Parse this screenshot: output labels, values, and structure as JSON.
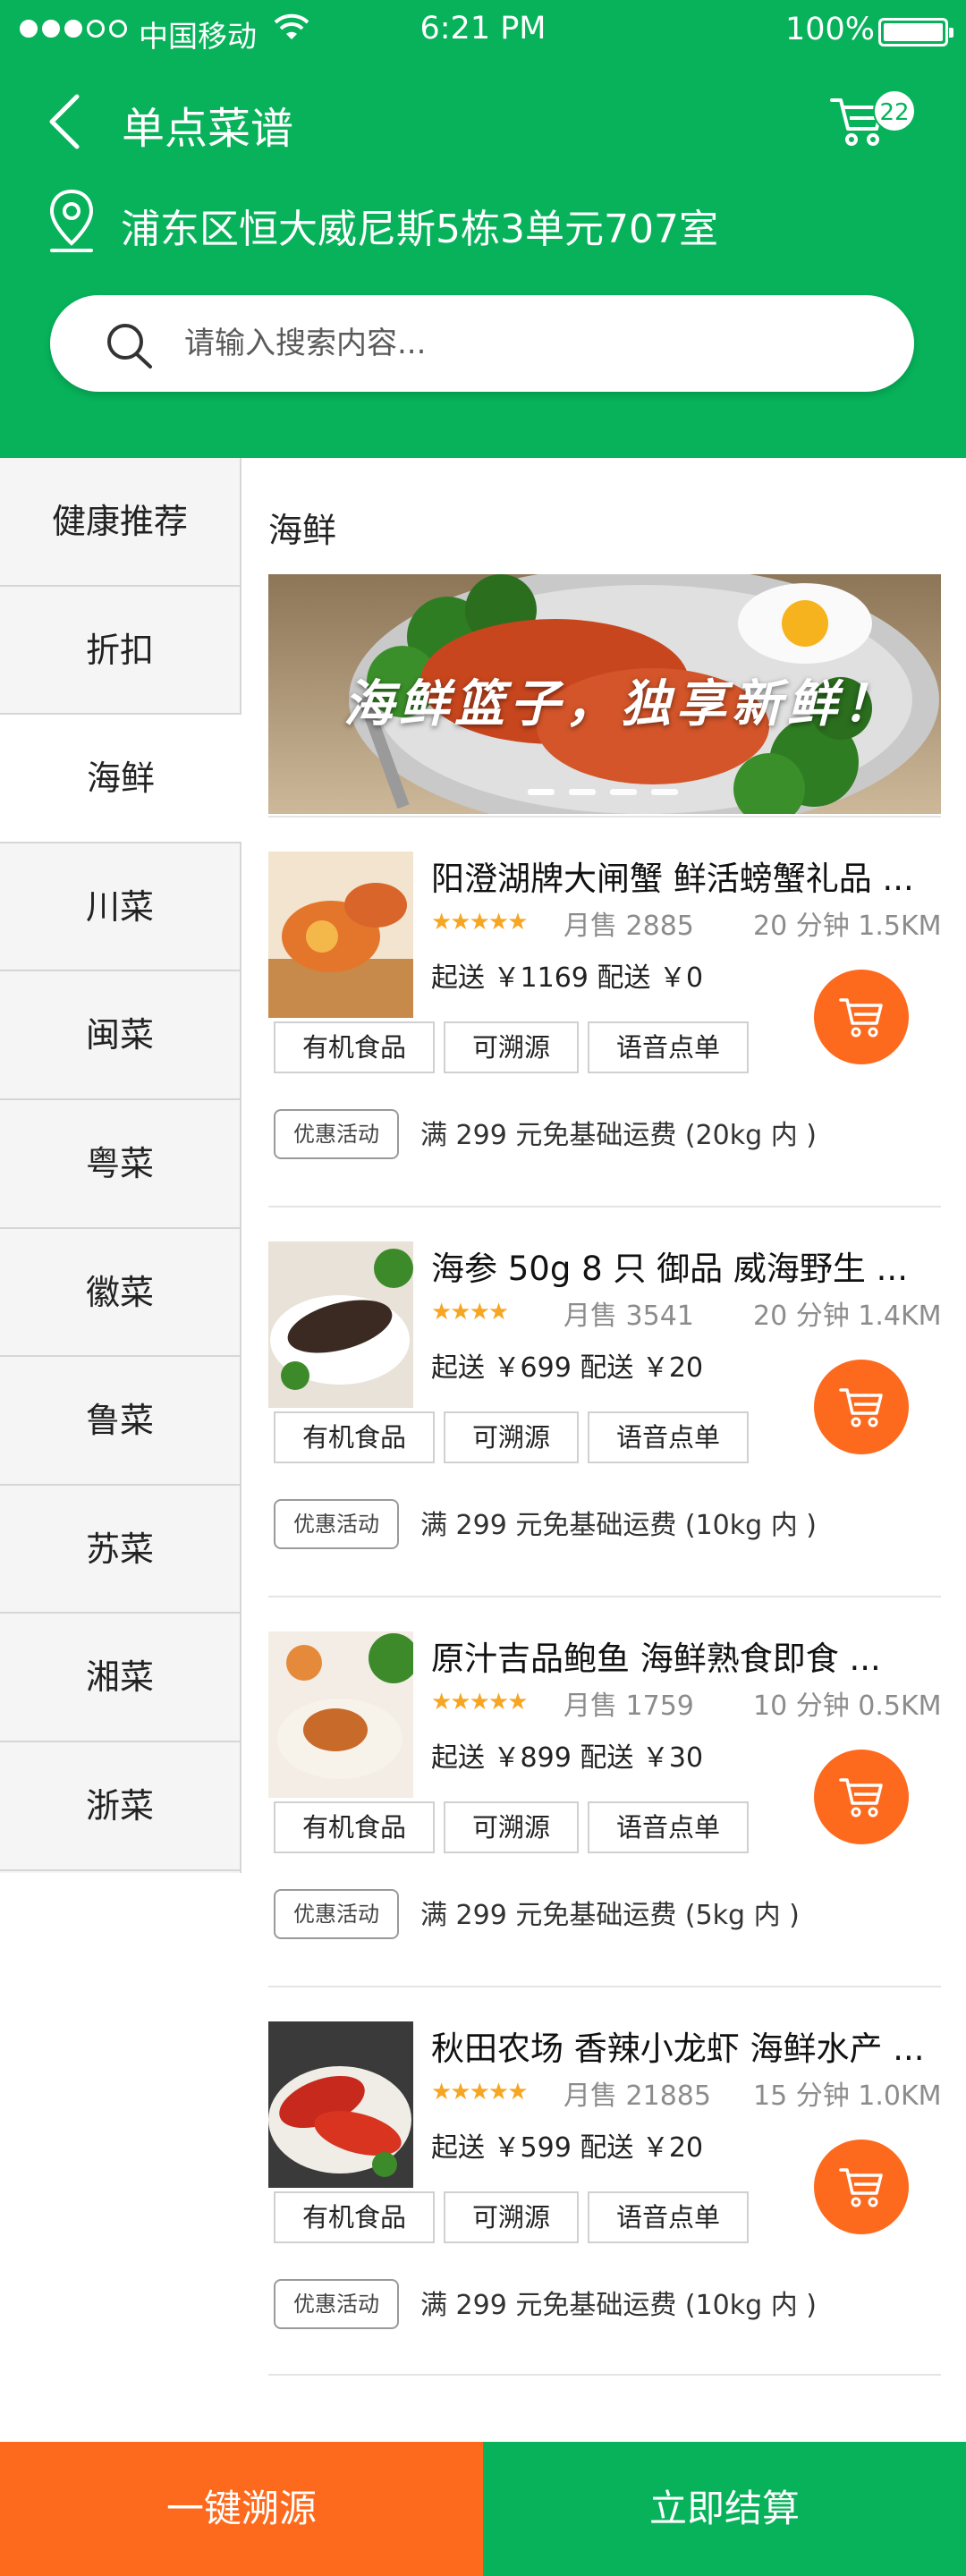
{
  "status_bar": {
    "carrier": "中国移动",
    "time": "6:21 PM",
    "battery": "100%",
    "battery_level": 1.0
  },
  "header": {
    "title": "单点菜谱",
    "cart_count": "22",
    "address": "浦东区恒大威尼斯5栋3单元707室",
    "search_placeholder": "请输入搜索内容..."
  },
  "sidebar": {
    "items": [
      {
        "label": "健康推荐"
      },
      {
        "label": "折扣"
      },
      {
        "label": "海鲜"
      },
      {
        "label": "川菜"
      },
      {
        "label": "闽菜"
      },
      {
        "label": "粤菜"
      },
      {
        "label": "徽菜"
      },
      {
        "label": "鲁菜"
      },
      {
        "label": "苏菜"
      },
      {
        "label": "湘菜"
      },
      {
        "label": "浙菜"
      }
    ],
    "active_index": 2
  },
  "content": {
    "section_title": "海鲜",
    "banner": {
      "slogan": "海鲜篮子，独享新鲜！",
      "slide_count": 4,
      "active_slide": 0
    },
    "tags": [
      "有机食品",
      "可溯源",
      "语音点单"
    ],
    "promo_label": "优惠活动",
    "products": [
      {
        "name": "阳澄湖牌大闸蟹 鲜活螃蟹礼品 ...",
        "stars": "★★★★★",
        "rating": 5,
        "sales": "月售 2885",
        "eta": "20 分钟   1.5KM",
        "price": "起送 ￥1169    配送 ￥0",
        "promo": "满 299 元免基础运费 (20kg 内 )"
      },
      {
        "name": "海参 50g 8 只 御品 威海野生 ...",
        "stars": "★★★★",
        "rating": 4,
        "sales": "月售 3541",
        "eta": "20 分钟  1.4KM",
        "price": "起送 ￥699    配送 ￥20",
        "promo": "满 299 元免基础运费 (10kg 内 )"
      },
      {
        "name": "原汁吉品鲍鱼 海鲜熟食即食 ...",
        "stars": "★★★★★",
        "rating": 5,
        "sales": "月售 1759",
        "eta": "10 分钟   0.5KM",
        "price": "起送 ￥899    配送 ￥30",
        "promo": "满 299 元免基础运费 (5kg 内 )"
      },
      {
        "name": "秋田农场 香辣小龙虾 海鲜水产 ...",
        "stars": "★★★★★",
        "rating": 5,
        "sales": "月售 21885",
        "eta": "15 分钟   1.0KM",
        "price": "起送 ￥599    配送 ￥20",
        "promo": "满 299 元免基础运费 (10kg 内 )"
      }
    ]
  },
  "bottom_bar": {
    "trace_label": "一键溯源",
    "checkout_label": "立即结算"
  },
  "colors": {
    "brand_green": "#07b25a",
    "accent_orange": "#fd6a1d",
    "star_yellow": "#f6a623"
  },
  "icons": {
    "back": "back-arrow-icon",
    "cart": "cart-icon",
    "pin": "location-pin-icon",
    "search": "search-icon",
    "add_to_cart": "cart-icon"
  }
}
